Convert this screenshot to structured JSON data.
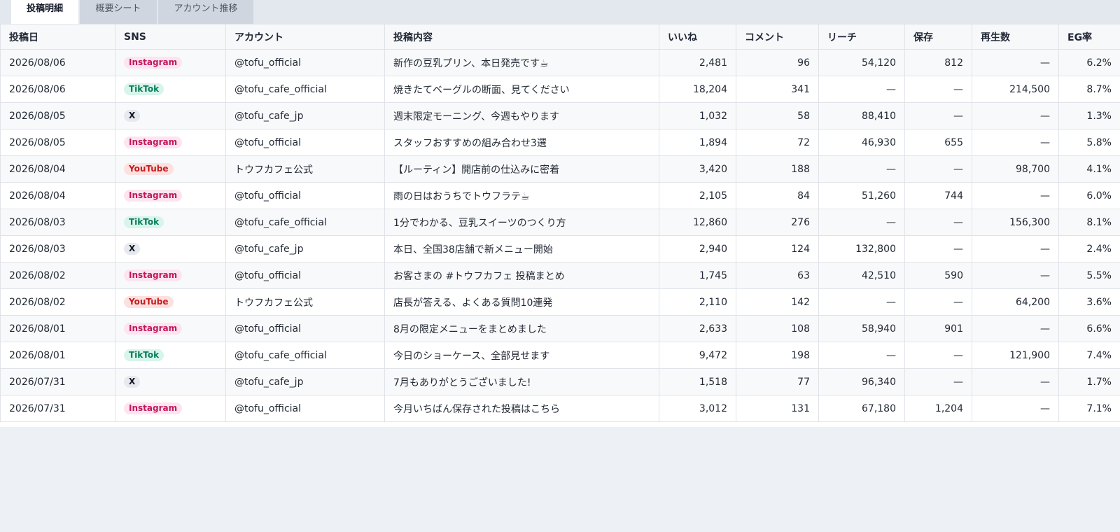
{
  "tabs": [
    {
      "label": "投稿明細"
    },
    {
      "label": "概要シート"
    },
    {
      "label": "アカウント推移"
    }
  ],
  "table": {
    "headers": [
      "投稿日",
      "SNS",
      "アカウント",
      "投稿内容",
      "いいね",
      "コメント",
      "リーチ",
      "保存",
      "再生数",
      "EG率"
    ],
    "rows": [
      {
        "date": "2026/08/06",
        "sns": "Instagram",
        "account": "@tofu_official",
        "content": "新作の豆乳プリン、本日発売です☕",
        "likes": "2,481",
        "comments": "96",
        "reach": "54,120",
        "saves": "812",
        "plays": "—",
        "eg": "6.2%"
      },
      {
        "date": "2026/08/06",
        "sns": "TikTok",
        "account": "@tofu_cafe_official",
        "content": "焼きたてベーグルの断面、見てください",
        "likes": "18,204",
        "comments": "341",
        "reach": "—",
        "saves": "—",
        "plays": "214,500",
        "eg": "8.7%"
      },
      {
        "date": "2026/08/05",
        "sns": "X",
        "account": "@tofu_cafe_jp",
        "content": "週末限定モーニング、今週もやります",
        "likes": "1,032",
        "comments": "58",
        "reach": "88,410",
        "saves": "—",
        "plays": "—",
        "eg": "1.3%"
      },
      {
        "date": "2026/08/05",
        "sns": "Instagram",
        "account": "@tofu_official",
        "content": "スタッフおすすめの組み合わせ3選",
        "likes": "1,894",
        "comments": "72",
        "reach": "46,930",
        "saves": "655",
        "plays": "—",
        "eg": "5.8%"
      },
      {
        "date": "2026/08/04",
        "sns": "YouTube",
        "account": "トウフカフェ公式",
        "content": "【ルーティン】開店前の仕込みに密着",
        "likes": "3,420",
        "comments": "188",
        "reach": "—",
        "saves": "—",
        "plays": "98,700",
        "eg": "4.1%"
      },
      {
        "date": "2026/08/04",
        "sns": "Instagram",
        "account": "@tofu_official",
        "content": "雨の日はおうちでトウフラテ☕",
        "likes": "2,105",
        "comments": "84",
        "reach": "51,260",
        "saves": "744",
        "plays": "—",
        "eg": "6.0%"
      },
      {
        "date": "2026/08/03",
        "sns": "TikTok",
        "account": "@tofu_cafe_official",
        "content": "1分でわかる、豆乳スイーツのつくり方",
        "likes": "12,860",
        "comments": "276",
        "reach": "—",
        "saves": "—",
        "plays": "156,300",
        "eg": "8.1%"
      },
      {
        "date": "2026/08/03",
        "sns": "X",
        "account": "@tofu_cafe_jp",
        "content": "本日、全国38店舗で新メニュー開始",
        "likes": "2,940",
        "comments": "124",
        "reach": "132,800",
        "saves": "—",
        "plays": "—",
        "eg": "2.4%"
      },
      {
        "date": "2026/08/02",
        "sns": "Instagram",
        "account": "@tofu_official",
        "content": "お客さまの #トウフカフェ 投稿まとめ",
        "likes": "1,745",
        "comments": "63",
        "reach": "42,510",
        "saves": "590",
        "plays": "—",
        "eg": "5.5%"
      },
      {
        "date": "2026/08/02",
        "sns": "YouTube",
        "account": "トウフカフェ公式",
        "content": "店長が答える、よくある質問10連発",
        "likes": "2,110",
        "comments": "142",
        "reach": "—",
        "saves": "—",
        "plays": "64,200",
        "eg": "3.6%"
      },
      {
        "date": "2026/08/01",
        "sns": "Instagram",
        "account": "@tofu_official",
        "content": "8月の限定メニューをまとめました",
        "likes": "2,633",
        "comments": "108",
        "reach": "58,940",
        "saves": "901",
        "plays": "—",
        "eg": "6.6%"
      },
      {
        "date": "2026/08/01",
        "sns": "TikTok",
        "account": "@tofu_cafe_official",
        "content": "今日のショーケース、全部見せます",
        "likes": "9,472",
        "comments": "198",
        "reach": "—",
        "saves": "—",
        "plays": "121,900",
        "eg": "7.4%"
      },
      {
        "date": "2026/07/31",
        "sns": "X",
        "account": "@tofu_cafe_jp",
        "content": "7月もありがとうございました!",
        "likes": "1,518",
        "comments": "77",
        "reach": "96,340",
        "saves": "—",
        "plays": "—",
        "eg": "1.7%"
      },
      {
        "date": "2026/07/31",
        "sns": "Instagram",
        "account": "@tofu_official",
        "content": "今月いちばん保存された投稿はこちら",
        "likes": "3,012",
        "comments": "131",
        "reach": "67,180",
        "saves": "1,204",
        "plays": "—",
        "eg": "7.1%"
      }
    ]
  },
  "colors": {
    "instagram": "#c0175d",
    "tiktok": "#0b7b59",
    "x": "#151a23",
    "youtube": "#c51d1d"
  }
}
